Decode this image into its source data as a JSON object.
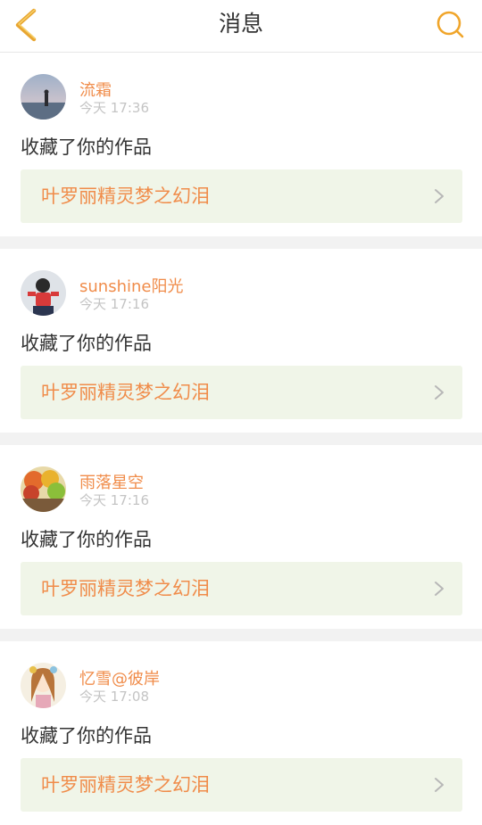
{
  "header": {
    "title": "消息",
    "back_icon": "chevron-left-icon",
    "search_icon": "search-icon",
    "accent": "#f0a52a"
  },
  "messages": [
    {
      "username": "流霜",
      "time": "今天 17:36",
      "action": "收藏了你的作品",
      "work_title": "叶罗丽精灵梦之幻泪"
    },
    {
      "username": "sunshine阳光",
      "time": "今天 17:16",
      "action": "收藏了你的作品",
      "work_title": "叶罗丽精灵梦之幻泪"
    },
    {
      "username": "雨落星空",
      "time": "今天 17:16",
      "action": "收藏了你的作品",
      "work_title": "叶罗丽精灵梦之幻泪"
    },
    {
      "username": "忆雪@彼岸",
      "time": "今天 17:08",
      "action": "收藏了你的作品",
      "work_title": "叶罗丽精灵梦之幻泪"
    }
  ],
  "colors": {
    "username": "#f08c4a",
    "work_title": "#f08c4a",
    "link_background": "#f0f5e8",
    "time": "#c4c4c4"
  }
}
